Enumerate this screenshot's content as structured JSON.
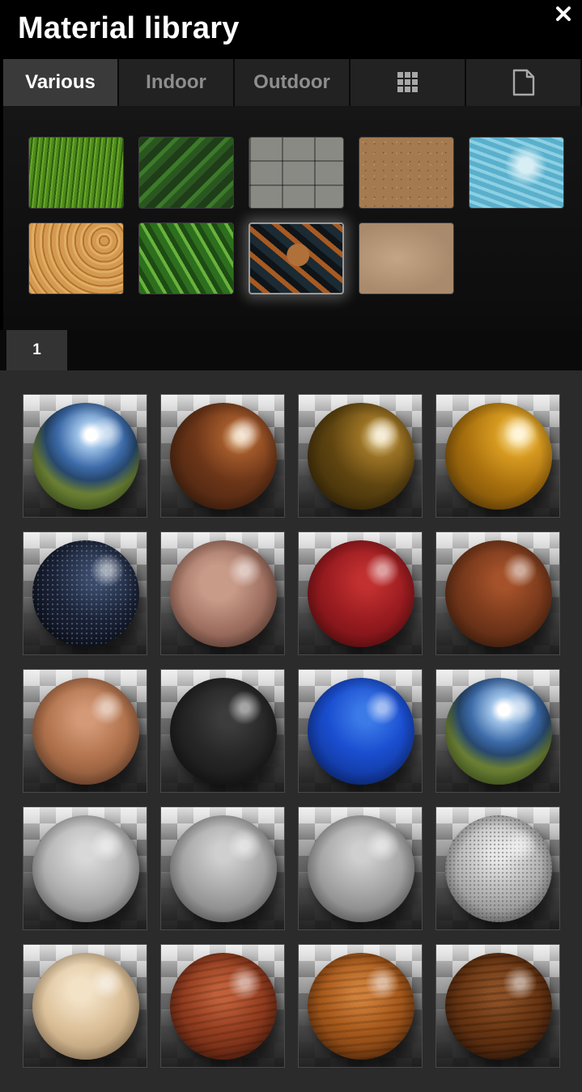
{
  "window": {
    "title": "Material library",
    "close_icon": "close-icon"
  },
  "tabs": [
    {
      "label": "Various",
      "active": true
    },
    {
      "label": "Indoor",
      "active": false
    },
    {
      "label": "Outdoor",
      "active": false
    },
    {
      "icon": "grid-icon",
      "active": false
    },
    {
      "icon": "document-icon",
      "active": false
    }
  ],
  "categories": [
    {
      "name": "grass",
      "selected": false
    },
    {
      "name": "leaves",
      "selected": false
    },
    {
      "name": "stone-wall",
      "selected": false
    },
    {
      "name": "dirt",
      "selected": false
    },
    {
      "name": "water",
      "selected": false
    },
    {
      "name": "wood-rings",
      "selected": false
    },
    {
      "name": "plant",
      "selected": false
    },
    {
      "name": "abstract-art",
      "selected": true
    },
    {
      "name": "sand",
      "selected": false
    }
  ],
  "pagination": {
    "pages": [
      "1"
    ],
    "current": "1"
  },
  "materials": [
    "chrome-green",
    "copper",
    "bronze",
    "gold",
    "dark-granite",
    "marble-red",
    "red",
    "rust",
    "terracotta",
    "black",
    "blue",
    "chrome-green",
    "grey",
    "grey-mid",
    "grey-mid",
    "stone",
    "wood-light",
    "wood-red",
    "wood-orange",
    "wood-dark"
  ],
  "colors": {
    "background": "#000000",
    "tab_active": "#3a3a3a",
    "tab_inactive": "#222222",
    "grid_background": "#2b2b2b"
  }
}
